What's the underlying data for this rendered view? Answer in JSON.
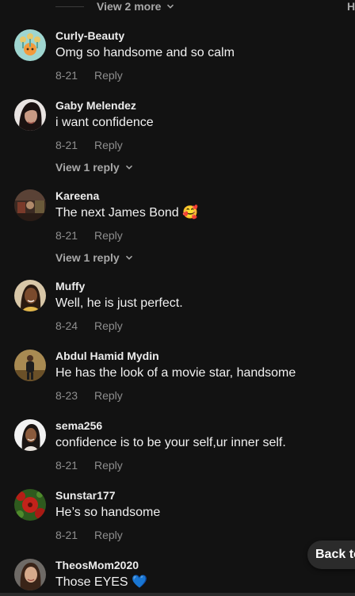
{
  "top": {
    "view_more": "View 2 more",
    "right_text": "H"
  },
  "comments": [
    {
      "user": "Curly-Beauty",
      "text": "Omg so handsome and so calm",
      "date": "8-21",
      "reply": "Reply"
    },
    {
      "user": "Gaby Melendez",
      "text": "i want confidence",
      "date": "8-21",
      "reply": "Reply",
      "view_replies": "View 1 reply"
    },
    {
      "user": "Kareena",
      "text": "The next James Bond 🥰",
      "date": "8-21",
      "reply": "Reply",
      "view_replies": "View 1 reply"
    },
    {
      "user": "Muffy",
      "text": "Well, he is just perfect.",
      "date": "8-24",
      "reply": "Reply"
    },
    {
      "user": "Abdul Hamid Mydin",
      "text": "He has the look of a movie star, handsome",
      "date": "8-23",
      "reply": "Reply"
    },
    {
      "user": "sema256",
      "text": "confidence is to be your self,ur inner self.",
      "date": "8-21",
      "reply": "Reply"
    },
    {
      "user": "Sunstar177",
      "text": "He’s so handsome",
      "date": "8-21",
      "reply": "Reply"
    },
    {
      "user": "TheosMom2020",
      "text": "Those EYES 💙"
    }
  ],
  "back_button": {
    "label": "Back to"
  },
  "colors": {
    "background": "#121212",
    "muted": "#8e8e8e",
    "pill": "#2b2b2b"
  }
}
